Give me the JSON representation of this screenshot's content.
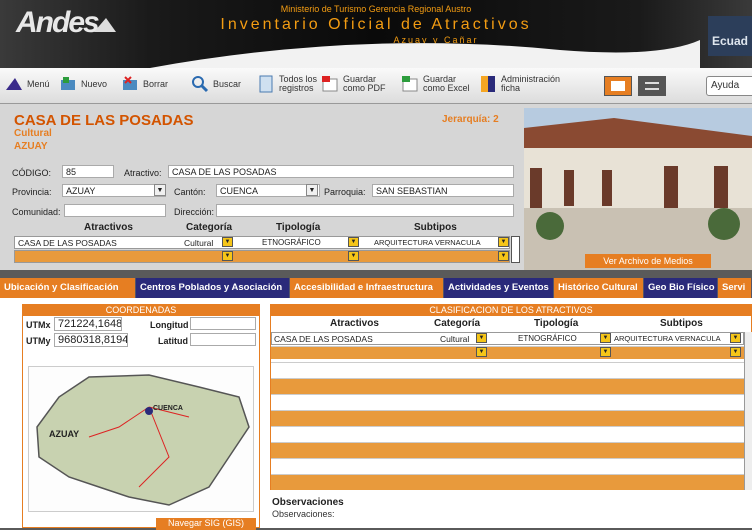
{
  "banner": {
    "logo": "Andes",
    "line1": "Ministerio de Turismo Gerencia Regional Austro",
    "line2": "Inventario Oficial de Atractivos",
    "line3": "Azuay y Cañar",
    "right": "Ecuad"
  },
  "toolbar": {
    "menu": "Menú",
    "nuevo": "Nuevo",
    "borrar": "Borrar",
    "buscar": "Buscar",
    "todos1": "Todos los",
    "todos2": "registros",
    "pdf1": "Guardar",
    "pdf2": "como PDF",
    "xls1": "Guardar",
    "xls2": "como Excel",
    "adm1": "Administración",
    "adm2": "ficha",
    "ayuda": "Ayuda"
  },
  "record": {
    "title": "CASA DE LAS POSADAS",
    "category": "Cultural",
    "province_label": "AZUAY",
    "jerarquia": "Jerarquía: 2",
    "codigo_label": "CÓDIGO:",
    "codigo": "85",
    "atractivo_label": "Atractivo:",
    "atractivo": "CASA DE LAS POSADAS",
    "provincia_label": "Provincia:",
    "provincia": "AZUAY",
    "canton_label": "Cantón:",
    "canton": "CUENCA",
    "parroquia_label": "Parroquia:",
    "parroquia": "SAN SEBASTIAN",
    "comunidad_label": "Comunidad:",
    "direccion_label": "Dirección:"
  },
  "grid": {
    "headers": [
      "Atractivos",
      "Categoría",
      "Tipología",
      "Subtipos"
    ],
    "row": [
      "CASA DE LAS POSADAS",
      "Cultural",
      "ETNOGRÁFICO",
      "ARQUITECTURA VERNACULA"
    ]
  },
  "photo": {
    "link": "Ver Archivo de Medios"
  },
  "tabs": [
    "Ubicación y Clasificación",
    "Centros Poblados y Asociación",
    "Accesibilidad e Infraestructura",
    "Actividades y Eventos",
    "Histórico Cultural",
    "Geo Bio Físico",
    "Servi"
  ],
  "coords": {
    "title": "COORDENADAS",
    "utmx_label": "UTMx",
    "utmx": "721224,1648",
    "utmy_label": "UTMy",
    "utmy": "9680318,8194",
    "lon_label": "Longitud",
    "lat_label": "Latitud"
  },
  "map": {
    "cuenca": "CUENCA",
    "azuay": "AZUAY",
    "sig": "Navegar SIG (GIS)"
  },
  "clasif": {
    "title": "CLASIFICACION DE LOS ATRACTIVOS",
    "headers": [
      "Atractivos",
      "Categoría",
      "Tipología",
      "Subtipos"
    ],
    "row": [
      "CASA DE LAS POSADAS",
      "Cultural",
      "ETNOGRÁFICO",
      "ARQUITECTURA VERNACULA"
    ]
  },
  "obs": {
    "title": "Observaciones",
    "label": "Observaciones:"
  },
  "colors": {
    "accent": "#e67e22",
    "tabbar": "#2a2a7a",
    "active_tab": "#e67e22"
  }
}
